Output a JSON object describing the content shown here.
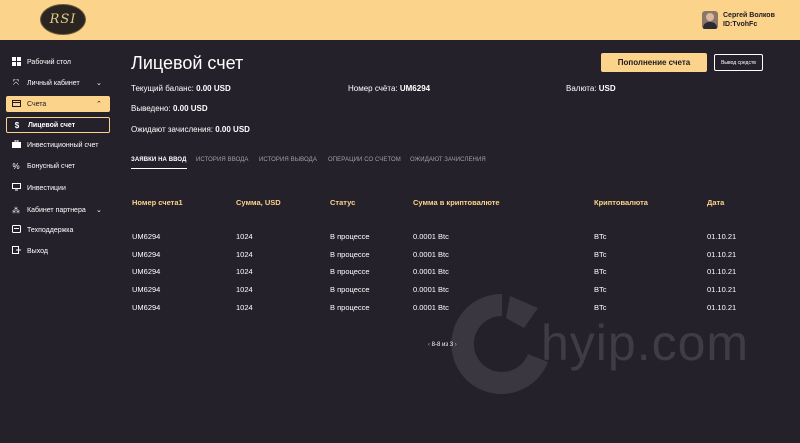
{
  "header": {
    "logo_text": "RSI",
    "user_name": "Сергей Волков",
    "user_id": "ID:TvohFc"
  },
  "sidebar": {
    "items": [
      {
        "label": "Рабочий стол",
        "icon": "grid-icon"
      },
      {
        "label": "Личный кабинет",
        "icon": "arrows-icon"
      },
      {
        "label": "Счета",
        "icon": "card-icon"
      },
      {
        "label": "Лицевой счет",
        "icon": "dollar-icon"
      },
      {
        "label": "Инвестиционный счет",
        "icon": "briefcase-icon"
      },
      {
        "label": "Бонусный счет",
        "icon": "percent-icon"
      },
      {
        "label": "Инвестиции",
        "icon": "monitor-icon"
      },
      {
        "label": "Кабинет партнера",
        "icon": "network-icon"
      },
      {
        "label": "Техподдержка",
        "icon": "support-icon"
      },
      {
        "label": "Выход",
        "icon": "exit-icon"
      }
    ]
  },
  "main": {
    "title": "Лицевой счет",
    "topup_label": "Пополнение счета",
    "withdraw_label": "Вывод средств",
    "info": {
      "balance_label": "Текущий баланс:",
      "balance_value": "0.00 USD",
      "account_label": "Номер счёта:",
      "account_value": "UM6294",
      "currency_label": "Валюта:",
      "currency_value": "USD",
      "withdrawn_label": "Выведено:",
      "withdrawn_value": "0.00 USD",
      "pending_label": "Ожидают зачисления:",
      "pending_value": "0.00 USD"
    },
    "tabs": [
      "Заявки на ввод",
      "История ввода",
      "История вывода",
      "Операции со счетом",
      "Ожидают зачисления"
    ],
    "table": {
      "headers": [
        "Номер счета1",
        "Сумма, USD",
        "Статус",
        "Сумма в криптовалюте",
        "Криптовалюта",
        "Дата"
      ],
      "rows": [
        [
          "UM6294",
          "1024",
          "В процессе",
          "0.0001 Btc",
          "BTc",
          "01.10.21"
        ],
        [
          "UM6294",
          "1024",
          "В процессе",
          "0.0001 Btc",
          "BTc",
          "01.10.21"
        ],
        [
          "UM6294",
          "1024",
          "В процессе",
          "0.0001 Btc",
          "BTc",
          "01.10.21"
        ],
        [
          "UM6294",
          "1024",
          "В процессе",
          "0.0001 Btc",
          "BTc",
          "01.10.21"
        ],
        [
          "UM6294",
          "1024",
          "В процессе",
          "0.0001 Btc",
          "BTc",
          "01.10.21"
        ]
      ]
    },
    "pagination": {
      "prev": "‹",
      "label": "8-8 из 3",
      "next": "›"
    }
  },
  "watermark": {
    "text": "hyip.com"
  },
  "colors": {
    "accent": "#fbd38a",
    "background": "#25212b",
    "text": "#ffffff"
  }
}
